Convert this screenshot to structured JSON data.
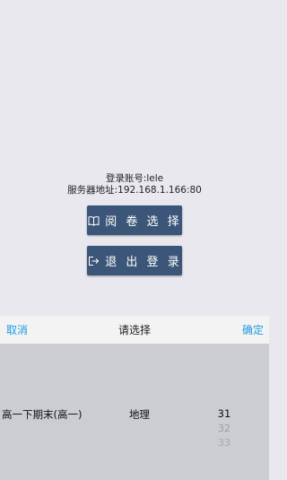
{
  "login_info": {
    "account": "登录账号:lele",
    "server": "服务器地址:192.168.1.166:80"
  },
  "buttons": {
    "review_label": "阅 卷 选 择",
    "review_icon": "book-icon",
    "logout_label": "退 出 登 录",
    "logout_icon": "logout-icon",
    "color": "#3b5679"
  },
  "picker": {
    "cancel": "取消",
    "title": "请选择",
    "confirm": "确定",
    "accent_color": "#1b9be0",
    "semester_selected": "高一下期末(高一)",
    "subject_selected": "地理",
    "number_selected": "31",
    "number_options": [
      "32",
      "33"
    ]
  }
}
